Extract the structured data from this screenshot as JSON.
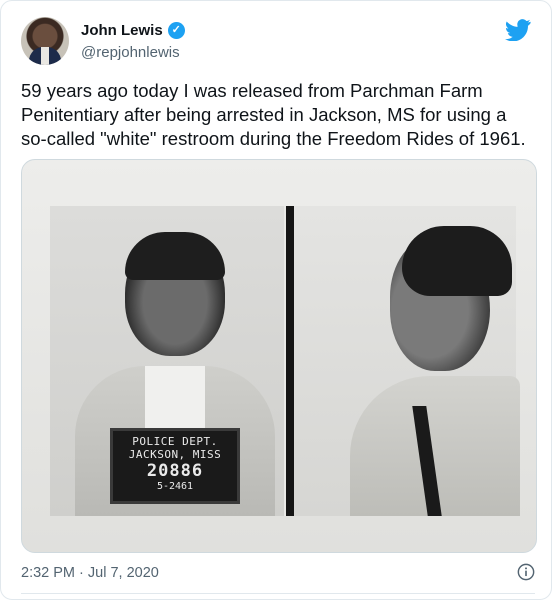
{
  "author": {
    "name": "John Lewis",
    "handle": "@repjohnlewis",
    "verified": true
  },
  "icons": {
    "brand": "twitter-bird-icon",
    "verified": "verified-badge-icon",
    "info": "info-icon"
  },
  "colors": {
    "accent": "#1da1f2",
    "text": "#0f1419",
    "muted": "#536471"
  },
  "tweet": {
    "text": "59 years ago today I was released from Parchman Farm\nPenitentiary after being arrested in Jackson, MS for using a\nso-called \"white\" restroom during the Freedom Rides of 1961.",
    "timestamp": "2:32 PM · Jul 7, 2020"
  },
  "media": {
    "placard": {
      "line1": "POLICE  DEPT.",
      "line2": "JACKSON, MISS",
      "number": "20886",
      "date": "5-2461"
    }
  }
}
